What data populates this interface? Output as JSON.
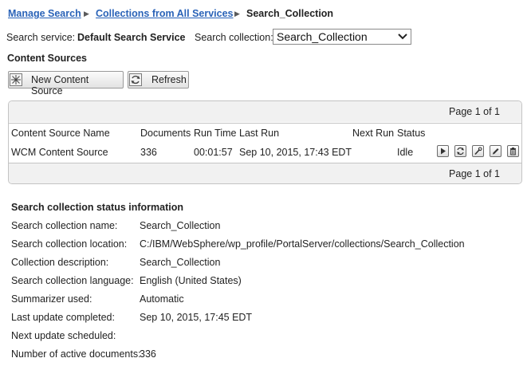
{
  "breadcrumb": {
    "items": [
      "Manage Search",
      "Collections from All Services"
    ],
    "current": "Search_Collection"
  },
  "service": {
    "label": "Search service:",
    "value": "Default Search Service",
    "collection_label": "Search collection:",
    "collection_value": "Search_Collection"
  },
  "content_sources": {
    "title": "Content Sources",
    "new_button": "New Content Source",
    "refresh_button": "Refresh"
  },
  "table": {
    "page_label": "Page 1 of 1",
    "headers": [
      "Content Source Name",
      "Documents",
      "Run Time",
      "Last Run",
      "Next Run",
      "Status"
    ],
    "row": {
      "name": "WCM Content Source",
      "documents": "336",
      "run_time": "00:01:57",
      "last_run": "Sep 10, 2015, 17:43 EDT",
      "next_run": "",
      "status": "Idle"
    },
    "actions": [
      "play-icon",
      "refresh-icon",
      "wrench-icon",
      "pencil-icon",
      "trash-icon"
    ]
  },
  "status_info": {
    "title": "Search collection status information",
    "rows": [
      {
        "k": "Search collection name:",
        "v": "Search_Collection"
      },
      {
        "k": "Search collection location:",
        "v": "C:/IBM/WebSphere/wp_profile/PortalServer/collections/Search_Collection"
      },
      {
        "k": "Collection description:",
        "v": "Search_Collection"
      },
      {
        "k": "Search collection language:",
        "v": "English (United States)"
      },
      {
        "k": "Summarizer used:",
        "v": "Automatic"
      },
      {
        "k": "Last update completed:",
        "v": "Sep 10, 2015, 17:45 EDT"
      },
      {
        "k": "Next update scheduled:",
        "v": ""
      },
      {
        "k": "Number of active documents:",
        "v": "336"
      }
    ]
  },
  "colors": {
    "link": "#2a63b8",
    "border": "#c4c4c4",
    "pagebar": "#f1f1f1"
  }
}
